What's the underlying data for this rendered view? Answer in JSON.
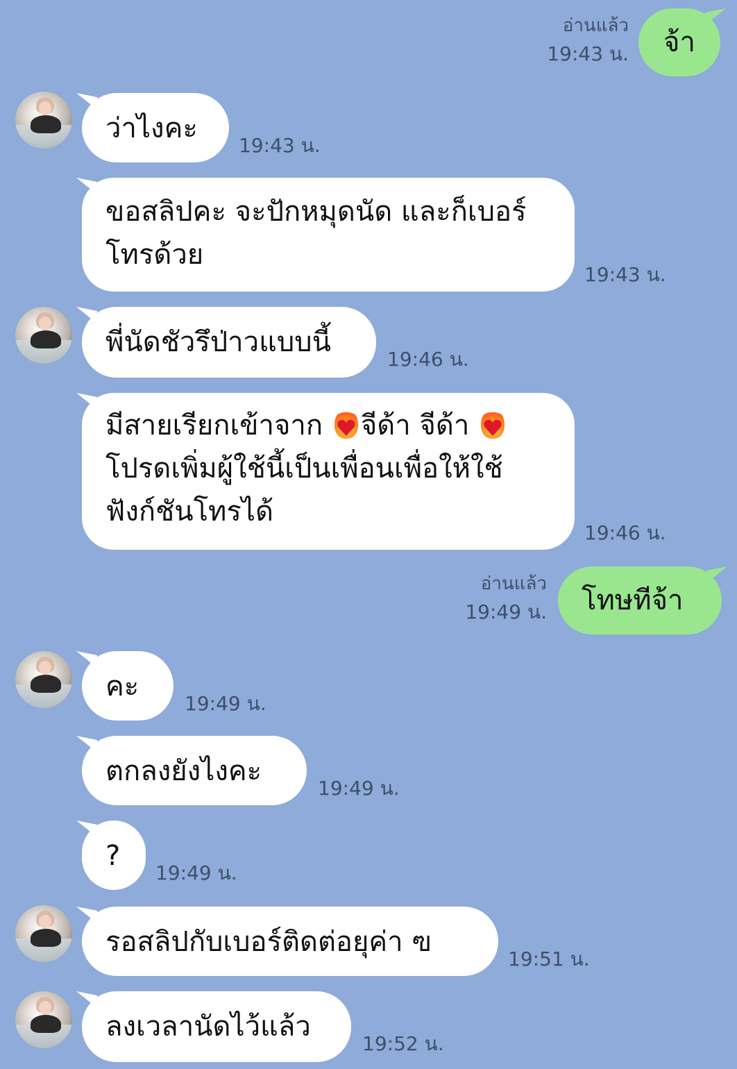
{
  "messages": [
    {
      "side": "out",
      "text": "จ้า",
      "read": "อ่านแล้ว",
      "time": "19:43 น."
    },
    {
      "side": "in",
      "text": "ว่าไงคะ",
      "time": "19:43 น.",
      "avatar": true
    },
    {
      "side": "in",
      "text": "ขอสลิปคะ จะปักหมุดนัด และก็เบอร์โทรด้วย",
      "time": "19:43 น."
    },
    {
      "side": "in",
      "text": "พี่นัดชัวรึป่าวแบบนี้",
      "time": "19:46 น.",
      "avatar": true
    },
    {
      "side": "in",
      "segments": [
        "มีสายเรียกเข้าจาก ",
        "heart-on-fire-emoji",
        "จีด้า จีด้า ",
        "heart-on-fire-emoji",
        " โปรดเพิ่มผู้ใช้นี้เป็นเพื่อนเพื่อให้ใช้ฟังก์ชันโทรได้"
      ],
      "time": "19:46 น."
    },
    {
      "side": "out",
      "text": "โทษทีจ้า",
      "read": "อ่านแล้ว",
      "time": "19:49 น."
    },
    {
      "side": "in",
      "text": "คะ",
      "time": "19:49 น.",
      "avatar": true
    },
    {
      "side": "in",
      "text": "ตกลงยังไงคะ",
      "time": "19:49 น."
    },
    {
      "side": "in",
      "text": "?",
      "time": "19:49 น."
    },
    {
      "side": "in",
      "text": "รอสลิปกับเบอร์ติดต่อยุค่า ฃ",
      "time": "19:51 น.",
      "avatar": true
    },
    {
      "side": "in",
      "text": "ลงเวลานัดไว้แล้ว",
      "time": "19:52 น.",
      "avatar": true
    }
  ],
  "colors": {
    "background": "#8eabd9",
    "incoming_bubble": "#ffffff",
    "outgoing_bubble": "#99e68f",
    "meta_text": "#3f4f68"
  }
}
